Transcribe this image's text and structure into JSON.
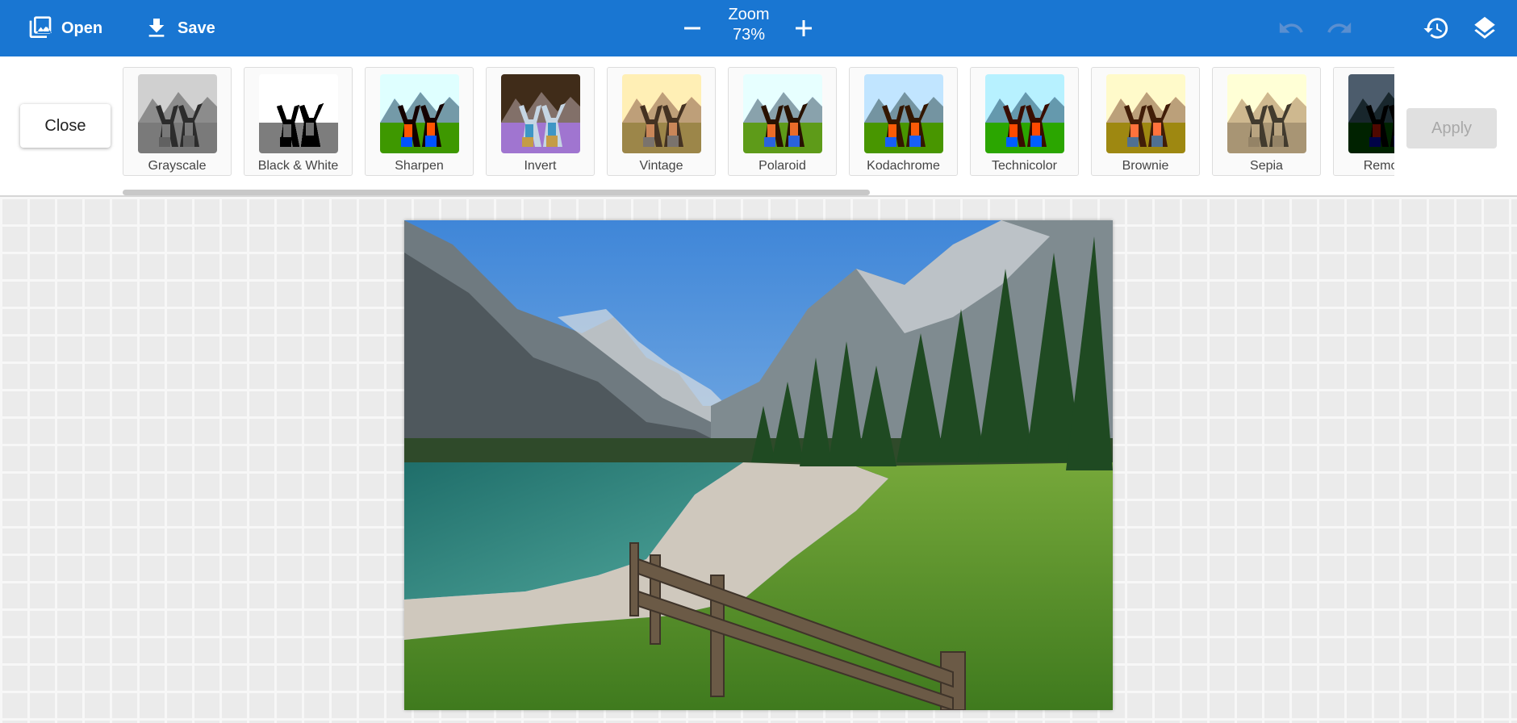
{
  "toolbar": {
    "open_label": "Open",
    "save_label": "Save",
    "zoom_label": "Zoom",
    "zoom_value": "73%",
    "icons": {
      "open": "image-icon",
      "save": "download-icon",
      "zoom_out": "minus-icon",
      "zoom_in": "plus-icon",
      "undo": "undo-icon",
      "redo": "redo-icon",
      "history": "history-icon",
      "layers": "layers-icon"
    },
    "colors": {
      "bar": "#1976d2",
      "disabled_icon": "#5a8fd0"
    }
  },
  "filters": {
    "close_label": "Close",
    "apply_label": "Apply",
    "items": [
      {
        "label": "Grayscale"
      },
      {
        "label": "Black & White"
      },
      {
        "label": "Sharpen"
      },
      {
        "label": "Invert"
      },
      {
        "label": "Vintage"
      },
      {
        "label": "Polaroid"
      },
      {
        "label": "Kodachrome"
      },
      {
        "label": "Technicolor"
      },
      {
        "label": "Brownie"
      },
      {
        "label": "Sepia"
      },
      {
        "label": "Remove"
      }
    ]
  }
}
